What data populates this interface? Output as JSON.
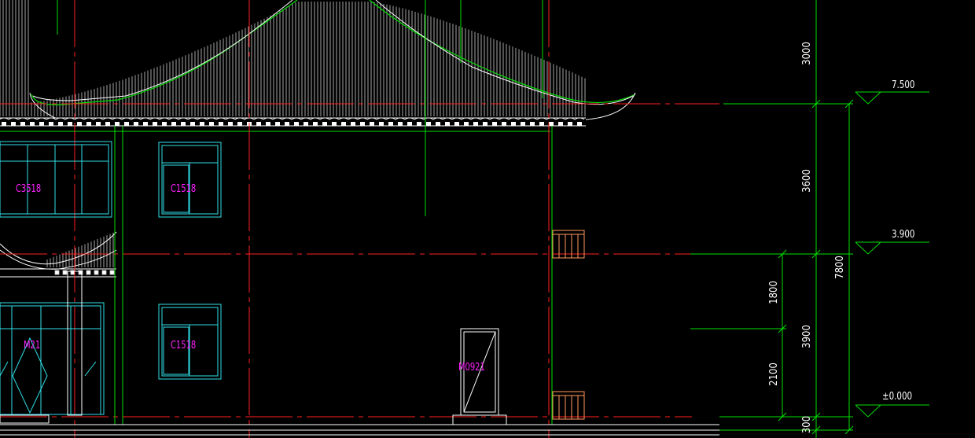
{
  "colors": {
    "background": "#000000",
    "axis_red": "#ff2020",
    "wall_green": "#00e000",
    "window_cyan": "#2fe0e8",
    "tag_magenta": "#ff22ff",
    "roof_white": "#ffffff",
    "rail_orange": "#ff9a60",
    "dim_white": "#ffffff"
  },
  "elevation_marks": {
    "level_roof": "7.500",
    "level_2": "3.900",
    "level_ground": "±0.000"
  },
  "dimensions": {
    "roof_height": "3000",
    "floor2_height": "3600",
    "total_height": "7800",
    "floor1_height": "3900",
    "upper_part": "1800",
    "lower_part": "2100",
    "plinth": "300"
  },
  "tags": {
    "window_left_upper": "C3518",
    "window_upper": "C1518",
    "window_lower": "C1518",
    "door_main": "M21",
    "door_side": "M0921"
  }
}
